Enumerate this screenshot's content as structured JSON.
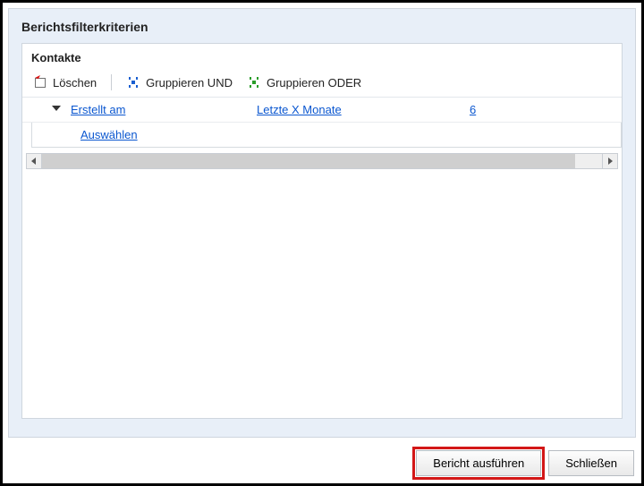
{
  "panel": {
    "title": "Berichtsfilterkriterien"
  },
  "section": {
    "title": "Kontakte"
  },
  "toolbar": {
    "delete_label": "Löschen",
    "group_and_label": "Gruppieren UND",
    "group_or_label": "Gruppieren ODER"
  },
  "criteria": {
    "row1": {
      "field": "Erstellt am",
      "operator": "Letzte X Monate",
      "value": "6"
    },
    "row2": {
      "select_label": "Auswählen"
    }
  },
  "footer": {
    "run_label": "Bericht ausführen",
    "close_label": "Schließen"
  }
}
